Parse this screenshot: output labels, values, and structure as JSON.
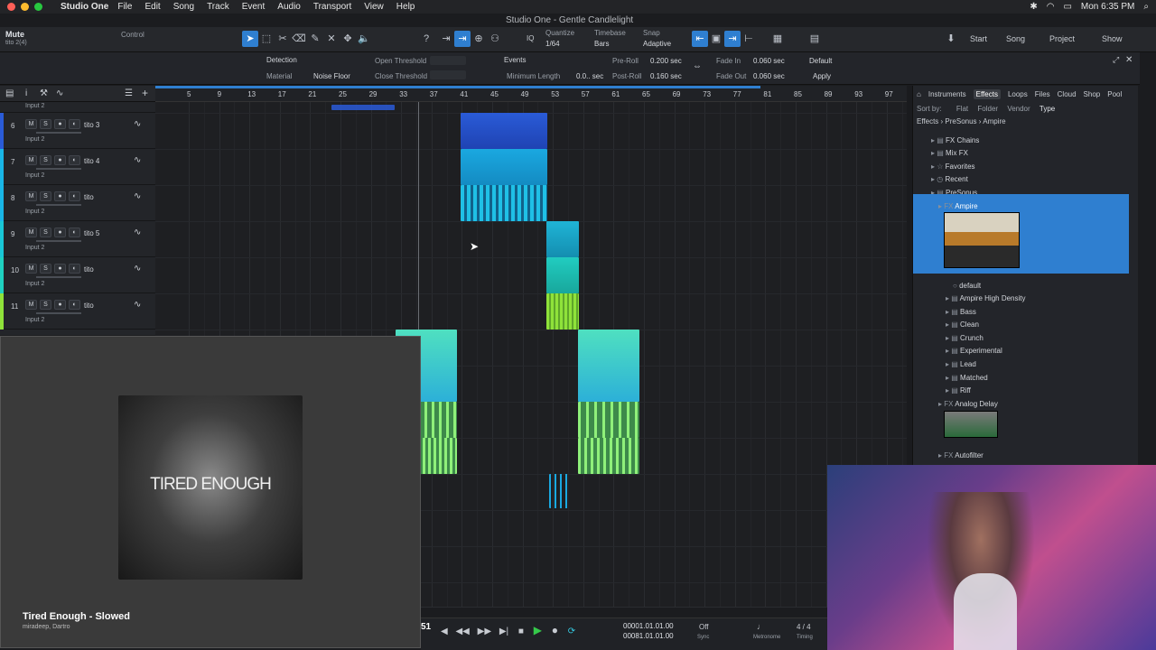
{
  "menubar": {
    "app_name": "Studio One",
    "items": [
      "File",
      "Edit",
      "Song",
      "Track",
      "Event",
      "Audio",
      "Transport",
      "View",
      "Help"
    ],
    "window_title": "Studio One - Gentle Candlelight",
    "clock": "Mon 6:35 PM"
  },
  "toolbar": {
    "track_label": "Mute",
    "track_sub": "tito 2(4)",
    "control_label": "Control",
    "quantize_label": "Quantize",
    "quantize_value": "1/64",
    "timebase_label": "Timebase",
    "timebase_value": "Bars",
    "snap_label": "Snap",
    "snap_value": "Adaptive",
    "iq": "IQ",
    "start": "Start",
    "song": "Song",
    "project": "Project",
    "show": "Show"
  },
  "inspector": {
    "detection": "Detection",
    "material": "Material",
    "noise_floor": "Noise Floor",
    "open_threshold": "Open Threshold",
    "close_threshold": "Close Threshold",
    "events": "Events",
    "min_length": "Minimum Length",
    "min_length_val": "0.0.. sec",
    "preroll": "Pre-Roll",
    "preroll_val": "0.200 sec",
    "postroll": "Post-Roll",
    "postroll_val": "0.160 sec",
    "fadein": "Fade In",
    "fadein_val": "0.060 sec",
    "fadeout": "Fade Out",
    "fadeout_val": "0.060 sec",
    "default": "Default",
    "apply": "Apply"
  },
  "ruler_ticks": [
    "5",
    "9",
    "13",
    "17",
    "21",
    "25",
    "29",
    "33",
    "37",
    "41",
    "45",
    "49",
    "53",
    "57",
    "61",
    "65",
    "69",
    "73",
    "77",
    "81",
    "85",
    "89",
    "93",
    "97"
  ],
  "tracks": [
    {
      "num": "6",
      "name": "tito 3",
      "input": "Input 2",
      "color": "#2a5bd7"
    },
    {
      "num": "7",
      "name": "tito 4",
      "input": "Input 2",
      "color": "#19b6e6"
    },
    {
      "num": "8",
      "name": "tito",
      "input": "Input 2",
      "color": "#19b6e6"
    },
    {
      "num": "9",
      "name": "tito 5",
      "input": "Input 2",
      "color": "#19c7d6"
    },
    {
      "num": "10",
      "name": "tito",
      "input": "Input 2",
      "color": "#1fd1c0"
    },
    {
      "num": "11",
      "name": "tito",
      "input": "Input 2",
      "color": "#8fe23a"
    }
  ],
  "track_buttons": {
    "m": "M",
    "s": "S",
    "r": "●",
    "mon": "◐",
    "o": "O"
  },
  "browser": {
    "tabs": [
      "Instruments",
      "Effects",
      "Loops",
      "Files",
      "Cloud",
      "Shop",
      "Pool"
    ],
    "sort_by": "Sort by:",
    "sort_opts": [
      "Flat",
      "Folder",
      "Vendor",
      "Type"
    ],
    "path": [
      "Effects",
      "PreSonus",
      "Ampire"
    ],
    "items": [
      {
        "label": "FX Chains",
        "icon": "folder-icon"
      },
      {
        "label": "Mix FX",
        "icon": "folder-icon"
      },
      {
        "label": "Favorites",
        "icon": "star-icon"
      },
      {
        "label": "Recent",
        "icon": "clock-icon"
      },
      {
        "label": "PreSonus",
        "icon": "folder-icon"
      },
      {
        "label": "Ampire",
        "icon": "fx-icon"
      },
      {
        "label": "default",
        "icon": "preset-icon"
      },
      {
        "label": "Ampire High Density",
        "icon": "folder-icon"
      },
      {
        "label": "Bass",
        "icon": "folder-icon"
      },
      {
        "label": "Clean",
        "icon": "folder-icon"
      },
      {
        "label": "Crunch",
        "icon": "folder-icon"
      },
      {
        "label": "Experimental",
        "icon": "folder-icon"
      },
      {
        "label": "Lead",
        "icon": "folder-icon"
      },
      {
        "label": "Matched",
        "icon": "folder-icon"
      },
      {
        "label": "Riff",
        "icon": "folder-icon"
      },
      {
        "label": "Analog Delay",
        "icon": "fx-icon"
      },
      {
        "label": "Autofilter",
        "icon": "fx-icon"
      }
    ]
  },
  "video": {
    "cover_text": "TIRED ENOUGH",
    "song_title": "Tired Enough - Slowed",
    "artists": "miradeep, Dartro"
  },
  "transport": {
    "bar_pos": "51",
    "time1": "00001.01.01.00",
    "time2": "00081.01.01.00",
    "sync": "Off",
    "sync_label": "Sync",
    "metronome": "Metronome",
    "timing": "Timing",
    "sig": "4 / 4"
  },
  "colors": {
    "accent": "#2f7fd0",
    "selection": "#2f7fd0",
    "clip_cyan": "#22c4e8",
    "clip_green": "#7fe05a",
    "clip_blue": "#2a5bd7"
  }
}
